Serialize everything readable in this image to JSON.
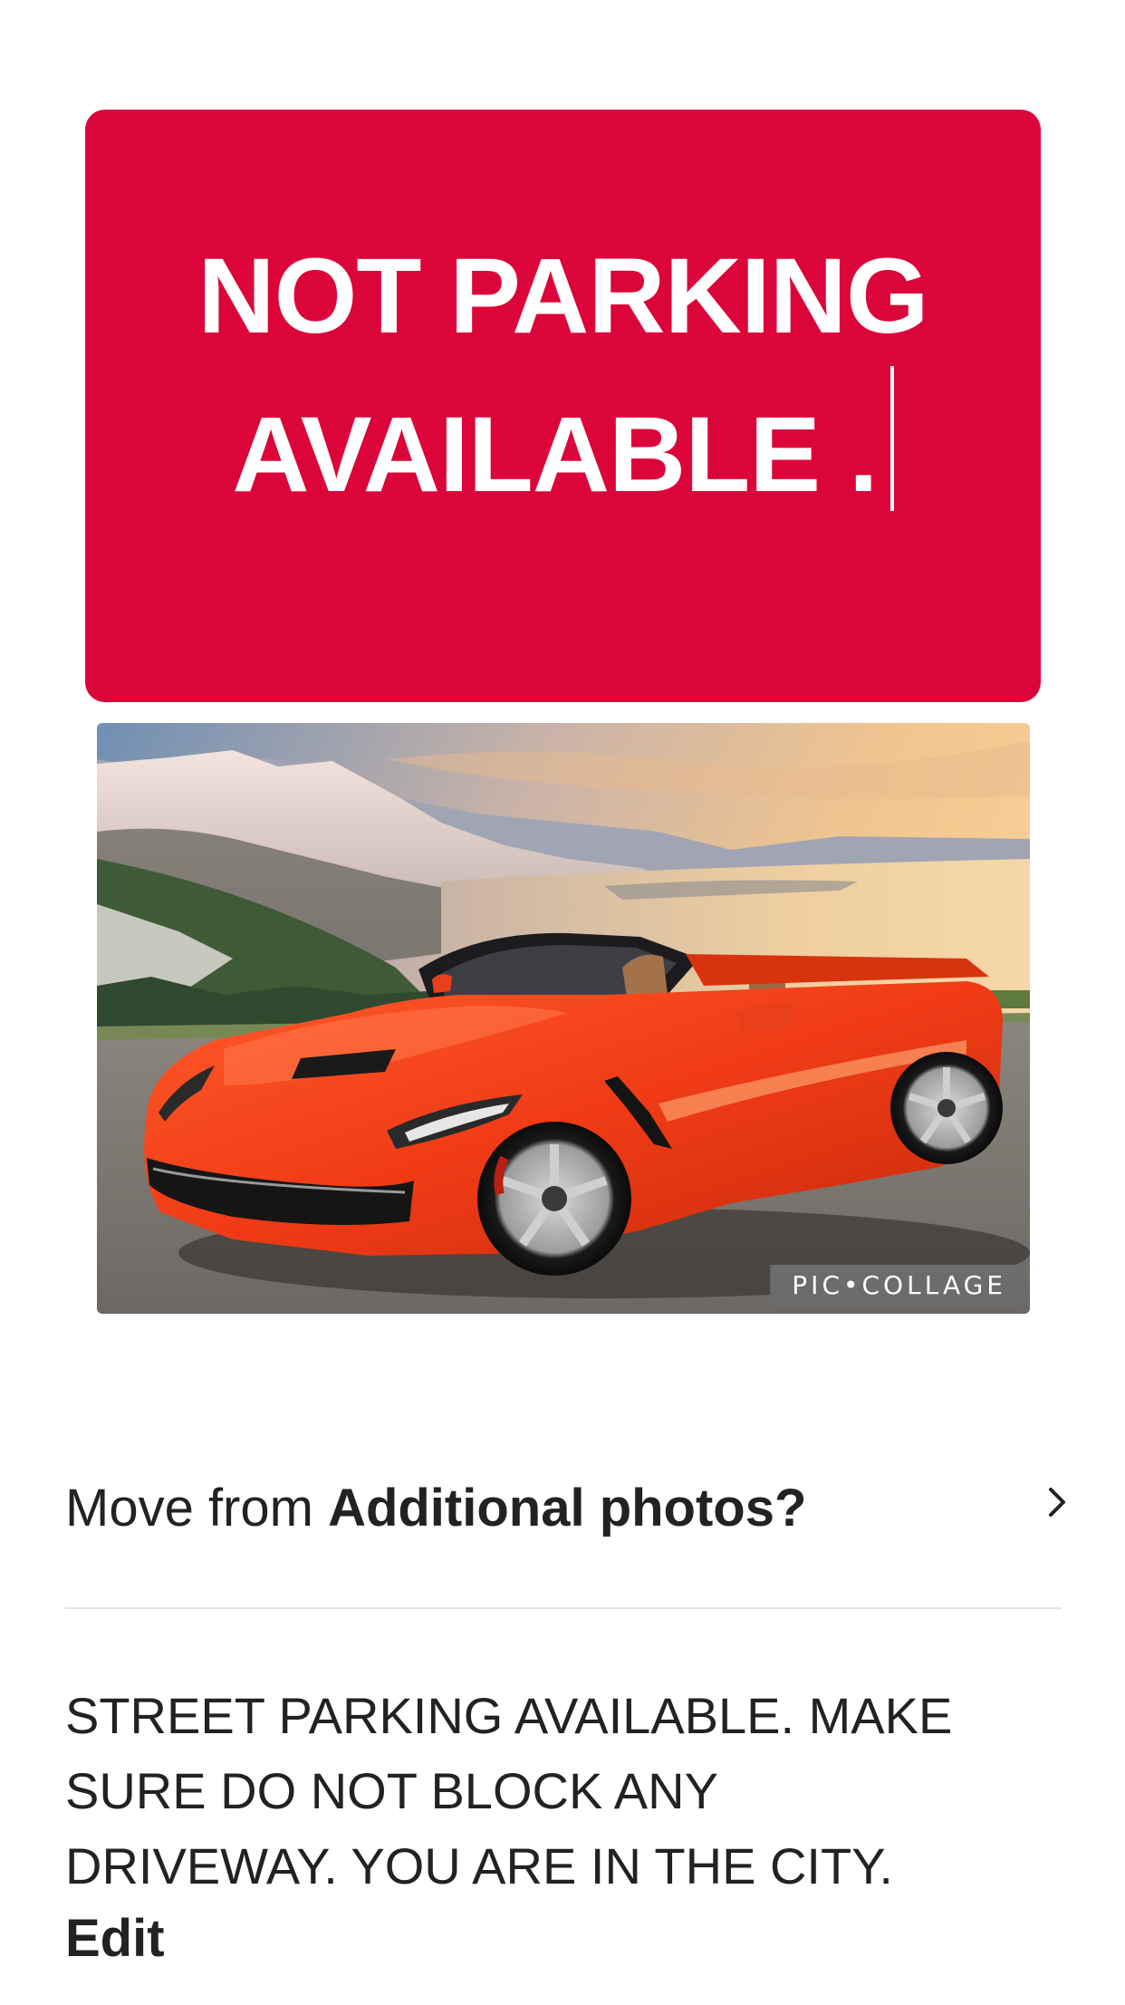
{
  "sign": {
    "line1": "NOT PARKING",
    "line2": "AVAILABLE .",
    "background": "#dc0539"
  },
  "photo": {
    "subject": "red convertible sports car with mountains and lake",
    "watermark": "PIC•COLLAGE"
  },
  "move": {
    "prefix": "Move from ",
    "bold": "Additional photos?",
    "icon": "chevron-right-icon"
  },
  "description": {
    "text": "STREET PARKING AVAILABLE.  MAKE\nSURE DO NOT BLOCK ANY\nDRIVEWAY.  YOU ARE IN THE CITY.",
    "edit_label": "Edit"
  }
}
